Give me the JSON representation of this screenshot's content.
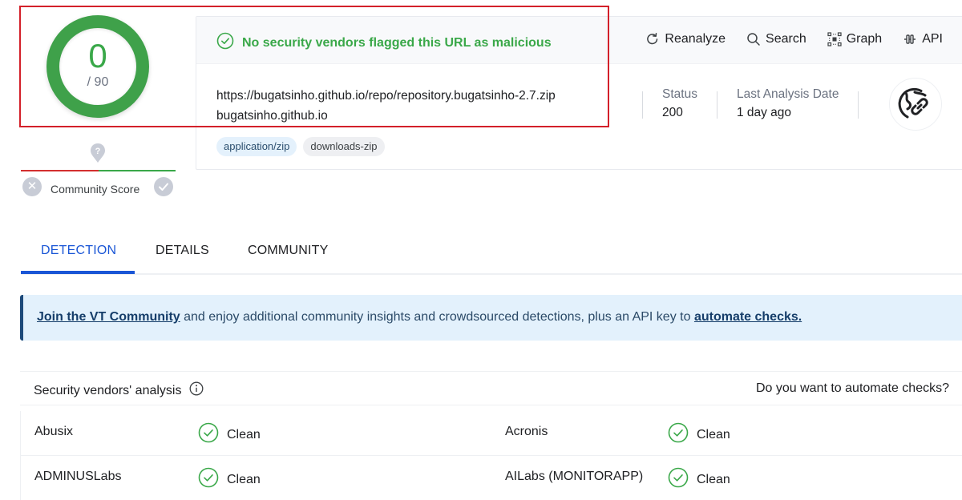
{
  "score": {
    "detections": "0",
    "total": "/ 90",
    "ring_color": "#3fa14a"
  },
  "community_score": {
    "label": "Community Score",
    "marker_icon": "question-marker-icon",
    "downvote_icon": "x-icon",
    "upvote_icon": "check-icon"
  },
  "verdict": {
    "icon": "check-circle-icon",
    "text": "No security vendors flagged this URL as malicious",
    "color": "#3aa849"
  },
  "actions": [
    {
      "label": "Reanalyze",
      "icon": "refresh-icon"
    },
    {
      "label": "Search",
      "icon": "search-icon"
    },
    {
      "label": "Graph",
      "icon": "graph-icon"
    },
    {
      "label": "API",
      "icon": "api-icon"
    }
  ],
  "target": {
    "url": "https://bugatsinho.github.io/repo/repository.bugatsinho-2.7.zip",
    "domain": "bugatsinho.github.io",
    "tags": [
      "application/zip",
      "downloads-zip"
    ]
  },
  "meta": {
    "status_label": "Status",
    "status_value": "200",
    "date_label": "Last Analysis Date",
    "date_value": "1 day ago",
    "type_icon": "globe-link-icon"
  },
  "tabs": [
    {
      "label": "DETECTION",
      "active": true
    },
    {
      "label": "DETAILS",
      "active": false
    },
    {
      "label": "COMMUNITY",
      "active": false
    }
  ],
  "banner": {
    "link1": "Join the VT Community",
    "middle": " and enjoy additional community insights and crowdsourced detections, plus an API key to ",
    "link2": "automate checks."
  },
  "vendors": {
    "title": "Security vendors' analysis",
    "automate_prompt": "Do you want to automate checks?",
    "rows": [
      [
        {
          "name": "Abusix",
          "result": "Clean"
        },
        {
          "name": "Acronis",
          "result": "Clean"
        }
      ],
      [
        {
          "name": "ADMINUSLabs",
          "result": "Clean"
        },
        {
          "name": "AILabs (MONITORAPP)",
          "result": "Clean"
        }
      ]
    ]
  }
}
